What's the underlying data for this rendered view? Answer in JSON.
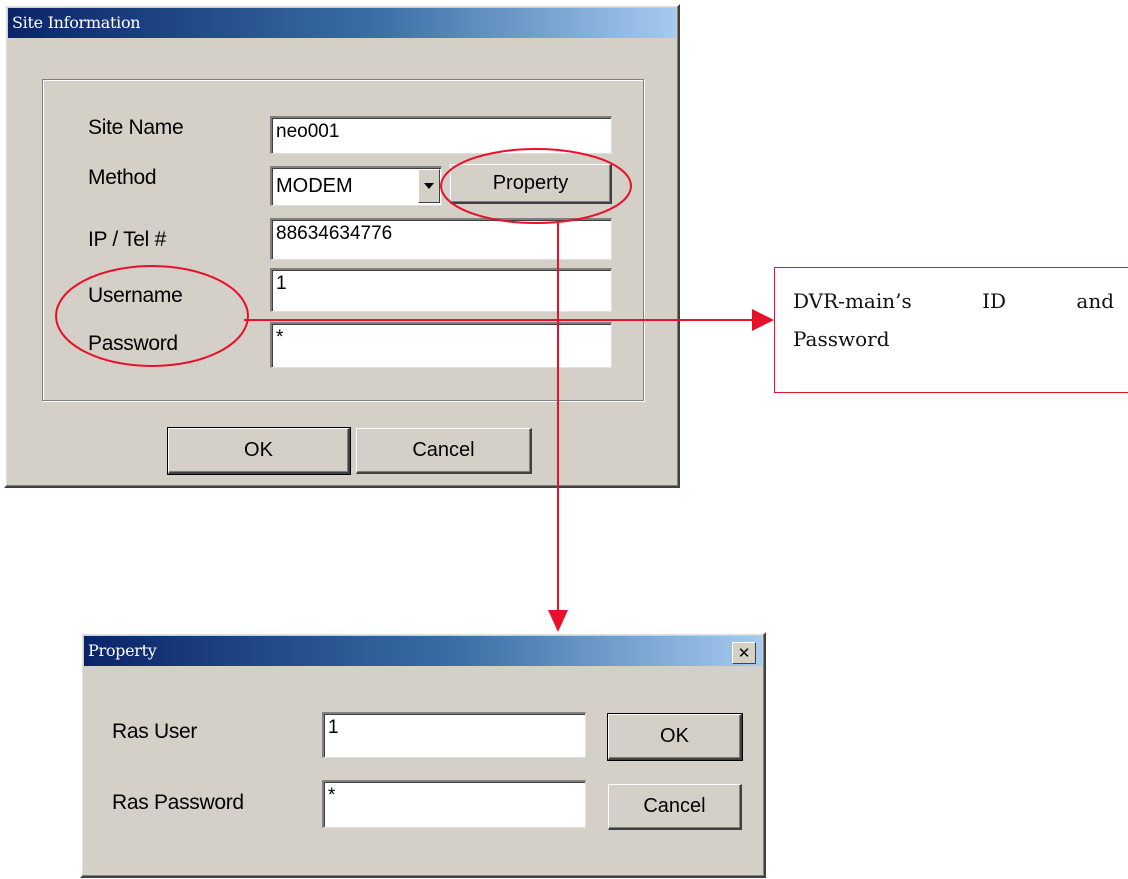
{
  "site_dialog": {
    "title": "Site Information",
    "fields": [
      {
        "label": "Site Name",
        "value": "neo001"
      },
      {
        "label": "Method",
        "value": "MODEM"
      },
      {
        "label": "IP / Tel #",
        "value": "88634634776"
      },
      {
        "label": "Username",
        "value": "1"
      },
      {
        "label": "Password",
        "value": "*"
      }
    ],
    "property_button": "Property",
    "ok_button": "OK",
    "cancel_button": "Cancel"
  },
  "property_dialog": {
    "title": "Property",
    "close_glyph": "✕",
    "fields": [
      {
        "label": "Ras User",
        "value": "1"
      },
      {
        "label": "Ras Password",
        "value": "*"
      }
    ],
    "ok_button": "OK",
    "cancel_button": "Cancel"
  },
  "callout": {
    "words": [
      "DVR-main’s",
      "ID",
      "and"
    ],
    "line2": "Password"
  },
  "colors": {
    "annotation_red": "#e8102a",
    "dialog_face": "#d4d0c8",
    "titlebar_start": "#0a246a"
  }
}
